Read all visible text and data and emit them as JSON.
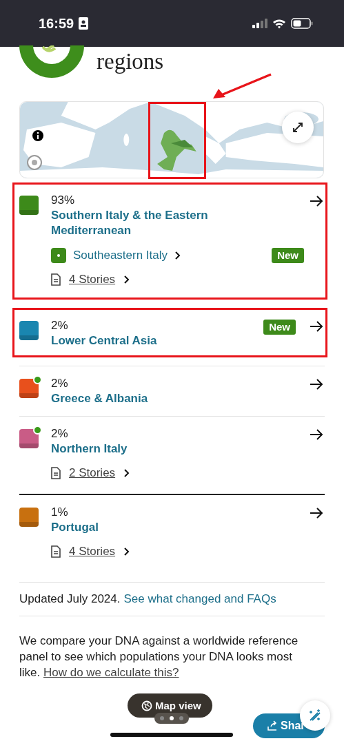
{
  "status_bar": {
    "time": "16:59"
  },
  "header": {
    "title": "regions"
  },
  "map": {
    "highlighted": true
  },
  "regions": [
    {
      "color": "#3d8a1a",
      "new_dot": false,
      "percent": "93%",
      "name": "Southern Italy & the Eastern Mediterranean",
      "highlighted": true,
      "subregion": {
        "name": "Southeastern Italy",
        "badge": "New"
      },
      "stories": "4 Stories",
      "thick_divider_above": false
    },
    {
      "color": "#1a86b0",
      "new_dot": false,
      "percent": "2%",
      "name": "Lower Central Asia",
      "highlighted": true,
      "badge": "New",
      "thick_divider_above": false
    },
    {
      "color": "#e8501c",
      "new_dot": true,
      "percent": "2%",
      "name": "Greece & Albania",
      "highlighted": false,
      "thick_divider_above": false
    },
    {
      "color": "#c95c86",
      "new_dot": true,
      "percent": "2%",
      "name": "Northern Italy",
      "highlighted": false,
      "stories": "2 Stories",
      "thick_divider_above": false
    },
    {
      "color": "#c8700f",
      "new_dot": false,
      "percent": "1%",
      "name": "Portugal",
      "highlighted": false,
      "stories": "4 Stories",
      "thick_divider_above": true
    }
  ],
  "updated": {
    "text": "Updated July 2024.",
    "link": "See what changed and FAQs"
  },
  "description": {
    "text": "We compare your DNA against a worldwide reference panel to see which populations your DNA looks most like.",
    "link": "How do we calculate this?"
  },
  "map_view_button": "Map view",
  "share_button": "Shar"
}
